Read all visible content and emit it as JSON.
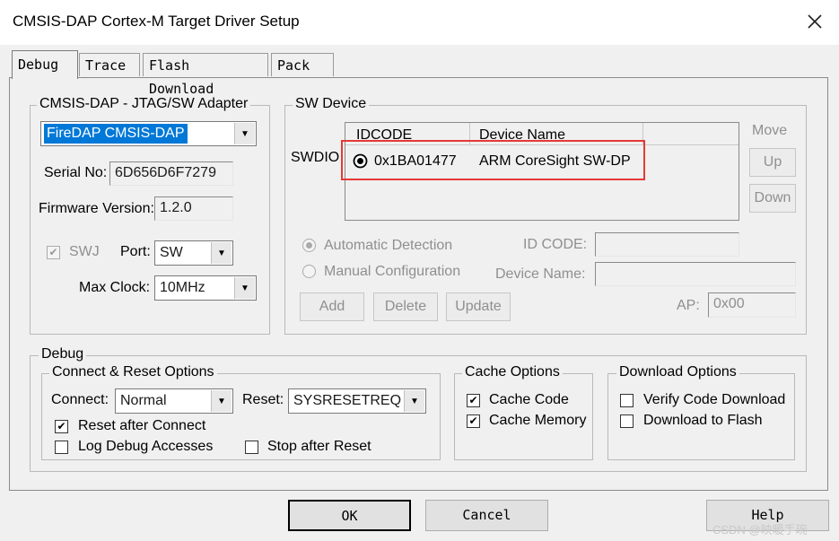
{
  "window": {
    "title": "CMSIS-DAP Cortex-M Target Driver Setup"
  },
  "tabs": [
    {
      "label": "Debug"
    },
    {
      "label": "Trace"
    },
    {
      "label": "Flash Download"
    },
    {
      "label": "Pack"
    }
  ],
  "adapter": {
    "title": "CMSIS-DAP - JTAG/SW Adapter",
    "selected": "FireDAP CMSIS-DAP",
    "serial_label": "Serial No:",
    "serial_value": "6D656D6F7279",
    "firmware_label": "Firmware Version:",
    "firmware_value": "1.2.0",
    "swj_label": "SWJ",
    "port_label": "Port:",
    "port_value": "SW",
    "maxclock_label": "Max Clock:",
    "maxclock_value": "10MHz"
  },
  "sw_device": {
    "title": "SW Device",
    "swdio_label": "SWDIO",
    "columns": [
      "IDCODE",
      "Device Name"
    ],
    "rows": [
      {
        "idcode": "0x1BA01477",
        "device_name": "ARM CoreSight SW-DP"
      }
    ],
    "move_label": "Move",
    "up_label": "Up",
    "down_label": "Down",
    "auto_detect_label": "Automatic Detection",
    "manual_config_label": "Manual Configuration",
    "idcode_label": "ID CODE:",
    "devicename_label": "Device Name:",
    "add_label": "Add",
    "delete_label": "Delete",
    "update_label": "Update",
    "ap_label": "AP:",
    "ap_value": "0x00",
    "highlight_color": "#e53935"
  },
  "debug": {
    "title": "Debug",
    "connect_reset": {
      "title": "Connect & Reset Options",
      "connect_label": "Connect:",
      "connect_value": "Normal",
      "reset_label": "Reset:",
      "reset_value": "SYSRESETREQ",
      "reset_after_connect": "Reset after Connect",
      "log_debug_accesses": "Log Debug Accesses",
      "stop_after_reset": "Stop after Reset"
    },
    "cache": {
      "title": "Cache Options",
      "cache_code": "Cache Code",
      "cache_memory": "Cache Memory"
    },
    "download": {
      "title": "Download Options",
      "verify": "Verify Code Download",
      "to_flash": "Download to Flash"
    }
  },
  "footer": {
    "ok_label": "OK",
    "cancel_label": "Cancel",
    "help_label": "Help",
    "watermark": "CSDN @映暖手琬"
  }
}
